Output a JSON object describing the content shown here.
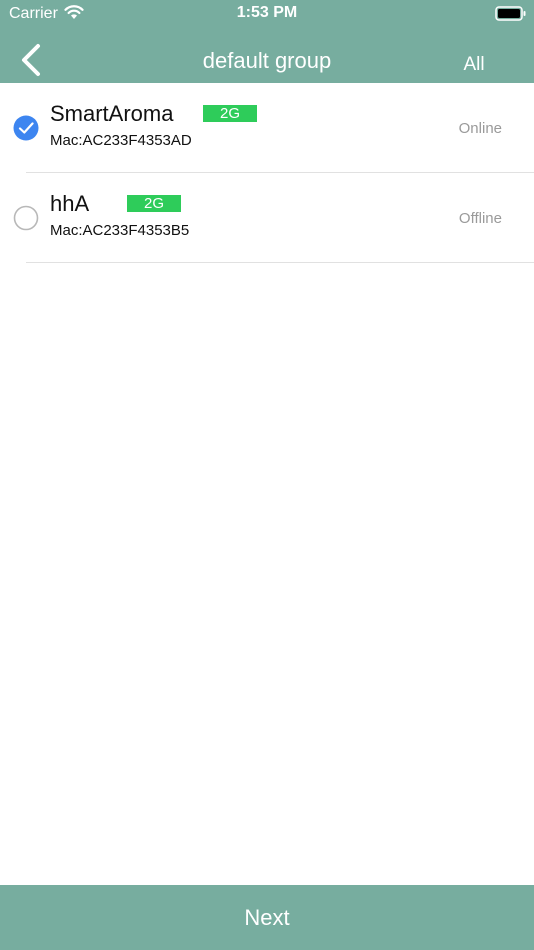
{
  "status_bar": {
    "carrier": "Carrier",
    "time": "1:53 PM"
  },
  "nav": {
    "title": "default group",
    "all_label": "All"
  },
  "devices": [
    {
      "name": "SmartAroma",
      "band": "2G",
      "mac": "Mac:AC233F4353AD",
      "status": "Online",
      "selected": true
    },
    {
      "name": "hhA",
      "band": "2G",
      "mac": "Mac:AC233F4353B5",
      "status": "Offline",
      "selected": false
    }
  ],
  "footer": {
    "next_label": "Next"
  },
  "colors": {
    "header": "#77ad9f",
    "badge": "#2ecc5a",
    "check": "#3d85f0"
  }
}
